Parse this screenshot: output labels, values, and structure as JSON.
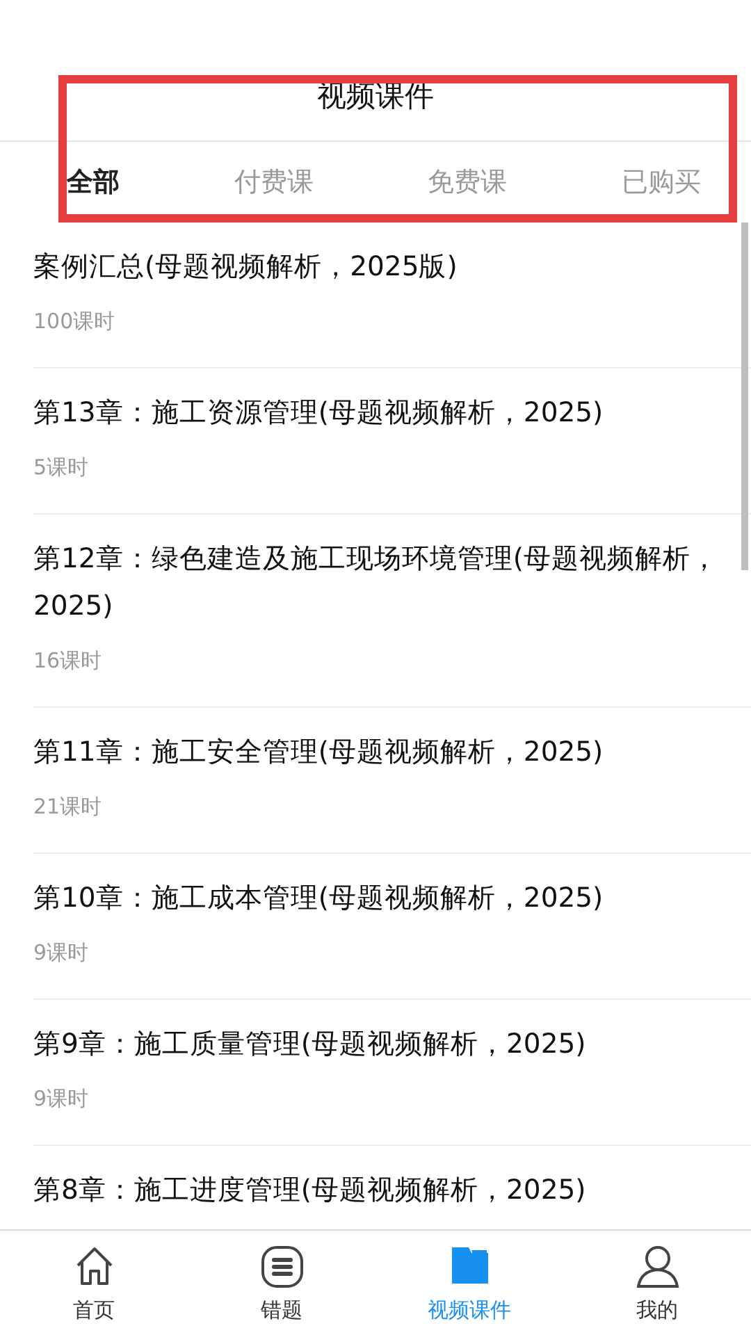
{
  "header": {
    "title": "视频课件"
  },
  "tabs": [
    {
      "label": "全部",
      "selected": true
    },
    {
      "label": "付费课",
      "selected": false
    },
    {
      "label": "免费课",
      "selected": false
    },
    {
      "label": "已购买",
      "selected": false
    }
  ],
  "courses": [
    {
      "title": "案例汇总(母题视频解析，2025版)",
      "lessons": "100课时"
    },
    {
      "title": "第13章：施工资源管理(母题视频解析，2025)",
      "lessons": "5课时"
    },
    {
      "title": "第12章：绿色建造及施工现场环境管理(母题视频解析，2025)",
      "lessons": "16课时"
    },
    {
      "title": "第11章：施工安全管理(母题视频解析，2025)",
      "lessons": "21课时"
    },
    {
      "title": "第10章：施工成本管理(母题视频解析，2025)",
      "lessons": "9课时"
    },
    {
      "title": "第9章：施工质量管理(母题视频解析，2025)",
      "lessons": "9课时"
    },
    {
      "title": "第8章：施工进度管理(母题视频解析，2025)"
    }
  ],
  "bottom_nav": [
    {
      "label": "首页",
      "selected": false
    },
    {
      "label": "错题",
      "selected": false
    },
    {
      "label": "视频课件",
      "selected": true
    },
    {
      "label": "我的",
      "selected": false
    }
  ],
  "highlight": {
    "kind": "frame"
  }
}
